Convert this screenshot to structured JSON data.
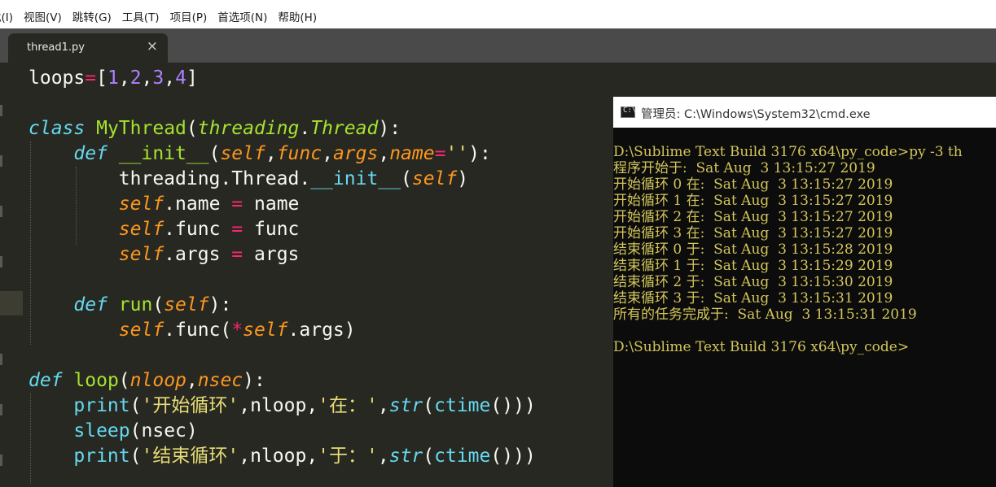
{
  "menubar": {
    "items": [
      "找(I)",
      "视图(V)",
      "跳转(G)",
      "工具(T)",
      "项目(P)",
      "首选项(N)",
      "帮助(H)"
    ]
  },
  "tab": {
    "filename": "thread1.py",
    "close_glyph": "×"
  },
  "editor": {
    "language": "python",
    "theme_colors": {
      "background": "#272822",
      "keyword": "#66d9ef",
      "class_name": "#a6e22e",
      "argument": "#fd971f",
      "operator": "#f92672",
      "string": "#e6db74",
      "number": "#ae81ff"
    },
    "lines": [
      "loops=[1,2,3,4]",
      "",
      "class MyThread(threading.Thread):",
      "    def __init__(self,func,args,name=''):",
      "        threading.Thread.__init__(self)",
      "        self.name = name",
      "        self.func = func",
      "        self.args = args",
      "",
      "    def run(self):",
      "        self.func(*self.args)",
      "",
      "def loop(nloop,nsec):",
      "    print('开始循环',nloop,'在：',str(ctime()))",
      "    sleep(nsec)",
      "    print('结束循环',nloop,'于：',str(ctime()))"
    ]
  },
  "cmd": {
    "icon_label": "C:\\",
    "title": "管理员: C:\\Windows\\System32\\cmd.exe",
    "text_color": "#d4c65a",
    "lines": [
      "D:\\Sublime Text Build 3176 x64\\py_code>py -3 th",
      "程序开始于:  Sat Aug  3 13:15:27 2019",
      "开始循环 0 在:  Sat Aug  3 13:15:27 2019",
      "开始循环 1 在:  Sat Aug  3 13:15:27 2019",
      "开始循环 2 在:  Sat Aug  3 13:15:27 2019",
      "开始循环 3 在:  Sat Aug  3 13:15:27 2019",
      "结束循环 0 于:  Sat Aug  3 13:15:28 2019",
      "结束循环 1 于:  Sat Aug  3 13:15:29 2019",
      "结束循环 2 于:  Sat Aug  3 13:15:30 2019",
      "结束循环 3 于:  Sat Aug  3 13:15:31 2019",
      "所有的任务完成于:  Sat Aug  3 13:15:31 2019",
      "",
      "D:\\Sublime Text Build 3176 x64\\py_code>"
    ]
  }
}
